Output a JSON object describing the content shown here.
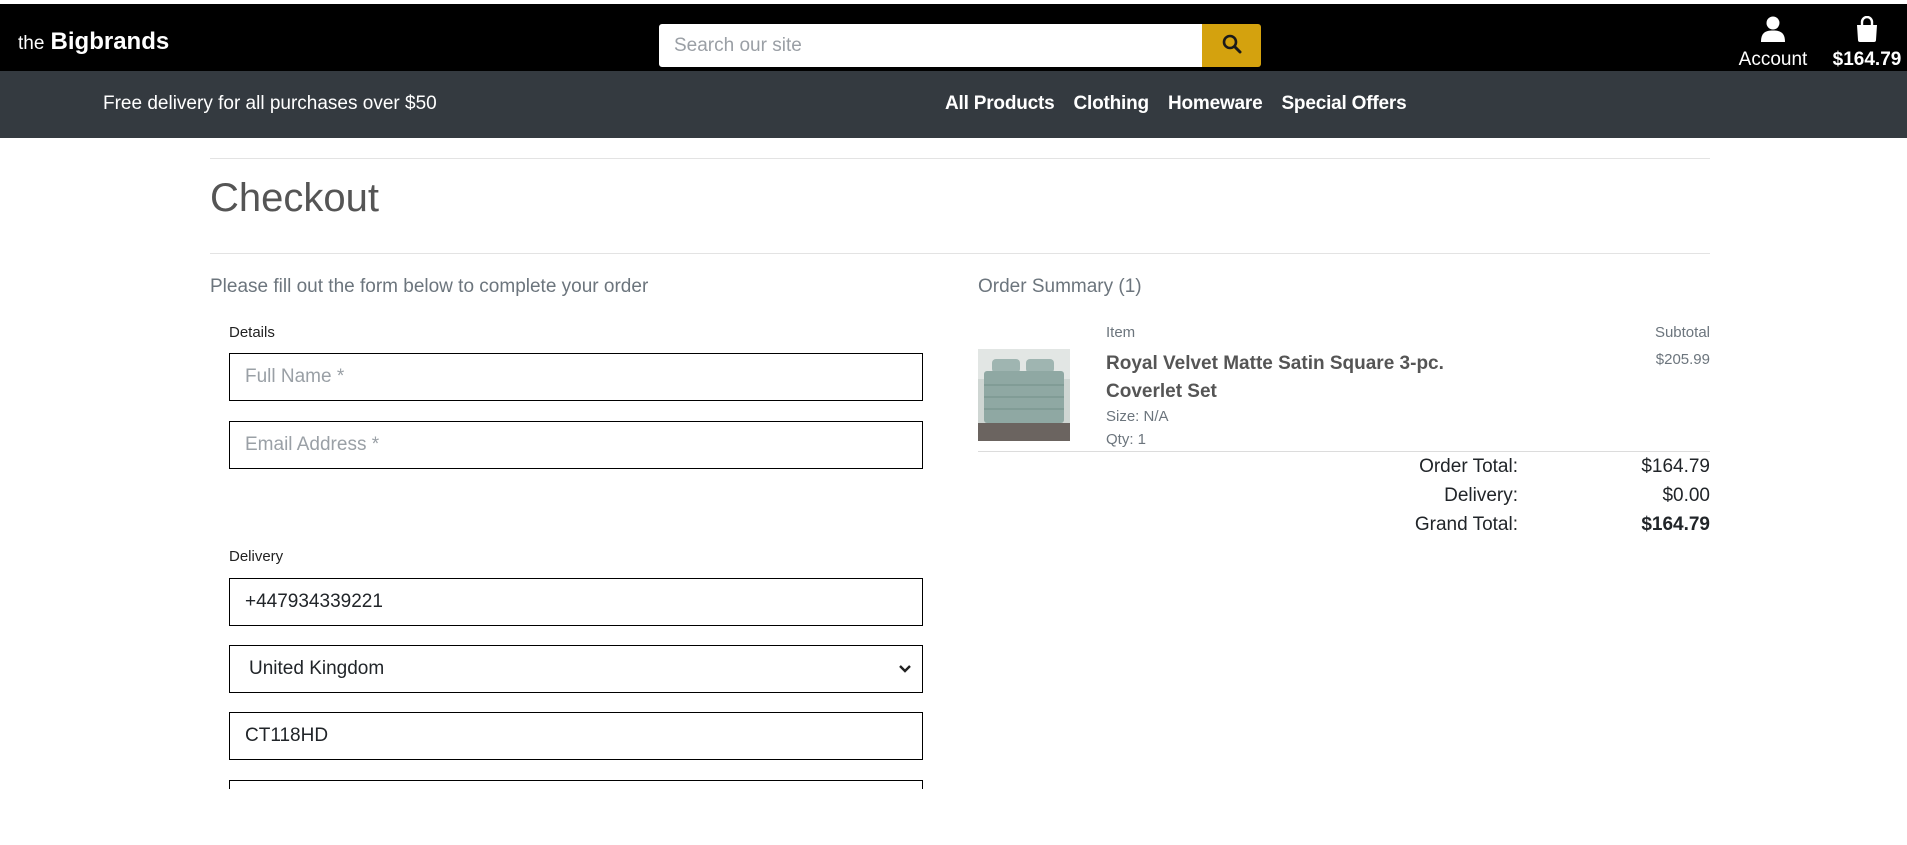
{
  "header": {
    "logo_prefix": "the",
    "logo_name": "Bigbrands",
    "search_placeholder": "Search our site",
    "account_label": "Account",
    "bag_total": "$164.79"
  },
  "navbar": {
    "promo": "Free delivery for all purchases over $50",
    "links": [
      "All Products",
      "Clothing",
      "Homeware",
      "Special Offers"
    ]
  },
  "checkout": {
    "title": "Checkout",
    "intro": "Please fill out the form below to complete your order",
    "details_label": "Details",
    "full_name_placeholder": "Full Name *",
    "email_placeholder": "Email Address *",
    "delivery_label": "Delivery",
    "phone_value": "+447934339221",
    "country_value": "United Kingdom",
    "postcode_value": "CT118HD"
  },
  "summary": {
    "title": "Order Summary (1)",
    "item_header": "Item",
    "subtotal_header": "Subtotal",
    "items": [
      {
        "name": "Royal Velvet Matte Satin Square 3-pc. Coverlet Set",
        "size": "Size: N/A",
        "qty": "Qty: 1",
        "subtotal": "$205.99"
      }
    ],
    "order_total_label": "Order Total:",
    "order_total": "$164.79",
    "delivery_label": "Delivery:",
    "delivery": "$0.00",
    "grand_total_label": "Grand Total:",
    "grand_total": "$164.79"
  },
  "colors": {
    "topbar": "#000000",
    "navbar": "#343a40",
    "search_button": "#d4a20e"
  }
}
